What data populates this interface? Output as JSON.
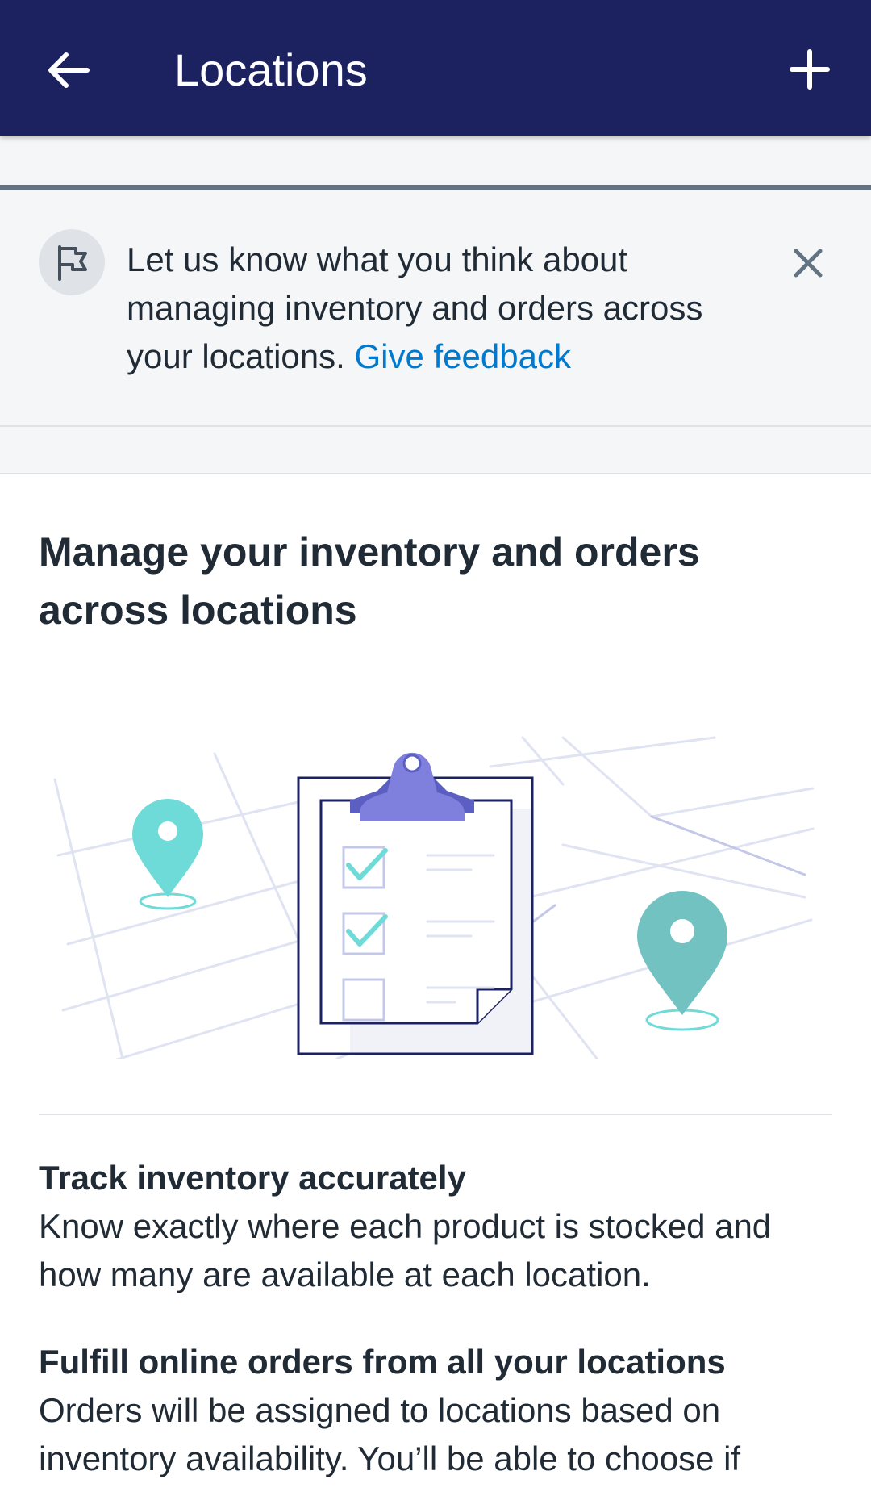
{
  "appbar": {
    "title": "Locations",
    "back_icon": "arrow-left-icon",
    "add_icon": "plus-icon"
  },
  "banner": {
    "message": "Let us know what you think about managing inventory and orders across your locations.",
    "link_label": "Give feedback",
    "icon": "flag-icon",
    "close_icon": "close-icon"
  },
  "card": {
    "heading": "Manage your inventory and orders across locations",
    "features": [
      {
        "title": "Track inventory accurately",
        "body": "Know exactly where each product is stocked and how many are available at each location."
      },
      {
        "title": "Fulfill online orders from all your locations",
        "body": "Orders will be assigned to locations based on inventory availability. You’ll be able to choose if"
      }
    ]
  },
  "colors": {
    "appbar": "#1c2260",
    "link": "#007ace",
    "pin_light": "#6fdbd8",
    "pin_dark": "#72c2c1",
    "clip": "#7f7fdd"
  }
}
